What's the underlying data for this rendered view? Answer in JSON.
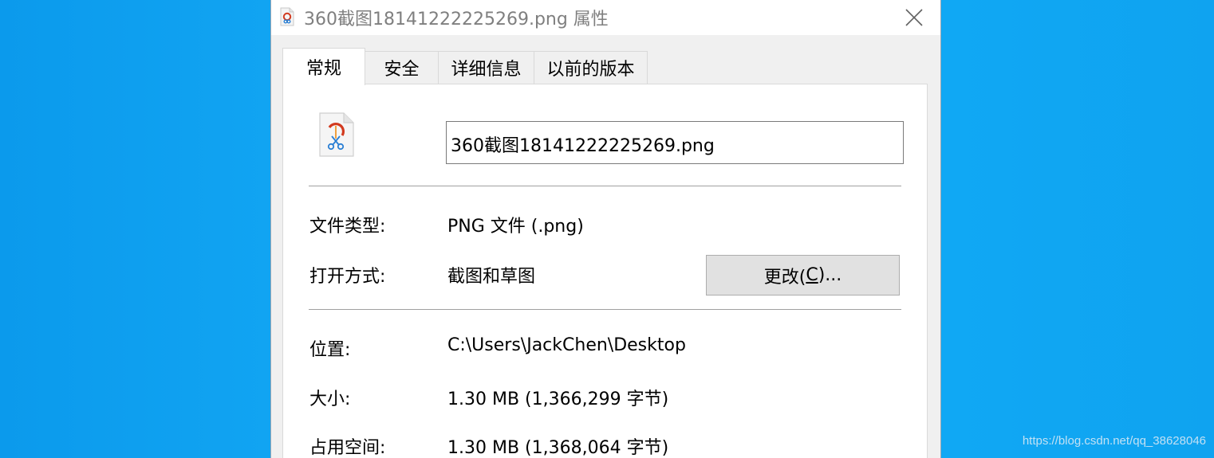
{
  "window": {
    "title": "360截图18141222225269.png 属性",
    "close_icon": "close-icon"
  },
  "tabs": [
    {
      "label": "常规",
      "active": true
    },
    {
      "label": "安全",
      "active": false
    },
    {
      "label": "详细信息",
      "active": false
    },
    {
      "label": "以前的版本",
      "active": false
    }
  ],
  "general": {
    "file_icon": "snipping-image-file-icon",
    "filename": "360截图18141222225269.png",
    "file_type_label": "文件类型:",
    "file_type_value": "PNG 文件 (.png)",
    "opens_with_label": "打开方式:",
    "opens_with_value": "截图和草图",
    "change_button_prefix": "更改(",
    "change_button_accel": "C",
    "change_button_suffix": ")...",
    "location_label": "位置:",
    "location_value": "C:\\Users\\JackChen\\Desktop",
    "size_label": "大小:",
    "size_value": "1.30 MB (1,366,299 字节)",
    "size_on_disk_label": "占用空间:",
    "size_on_disk_value": "1.30 MB (1,368,064 字节)"
  },
  "watermark": "https://blog.csdn.net/qq_38628046",
  "colors": {
    "desktop": "#10a2f2",
    "title_text": "#7f7f7f",
    "button_bg": "#e1e1e1"
  }
}
